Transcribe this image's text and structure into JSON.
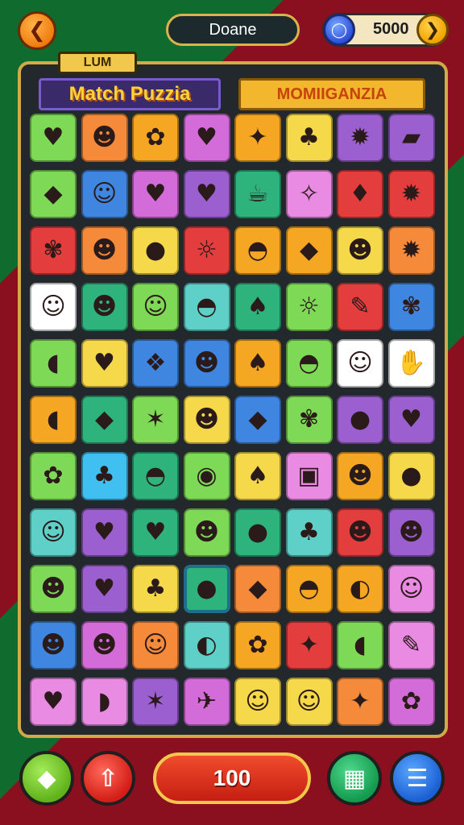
{
  "header": {
    "back_icon": "back-arrow-icon",
    "player_name": "Doane",
    "coins": "5000",
    "coin_icon": "coin-icon",
    "add_icon": "plus-icon"
  },
  "board": {
    "tag": "LUM",
    "title_left": "Match Puzzia",
    "title_right": "MOMIIGANZIA",
    "rows": [
      [
        {
          "g": "♥",
          "c": "#7ed957"
        },
        {
          "g": "☻",
          "c": "#f58a3a"
        },
        {
          "g": "✿",
          "c": "#f5a623"
        },
        {
          "g": "♥",
          "c": "#d36bd8"
        },
        {
          "g": "✦",
          "c": "#f5a623"
        },
        {
          "g": "♣",
          "c": "#f5d94a"
        },
        {
          "g": "✹",
          "c": "#9b5fd0"
        },
        {
          "g": "▰",
          "c": "#9b5fd0"
        }
      ],
      [
        {
          "g": "◆",
          "c": "#7ed957"
        },
        {
          "g": "☺",
          "c": "#3f86e0"
        },
        {
          "g": "♥",
          "c": "#d36bd8"
        },
        {
          "g": "♥",
          "c": "#9b5fd0"
        },
        {
          "g": "☕",
          "c": "#2fb37d"
        },
        {
          "g": "✧",
          "c": "#e98be3"
        },
        {
          "g": "♦",
          "c": "#e43d3d"
        },
        {
          "g": "✹",
          "c": "#e43d3d"
        }
      ],
      [
        {
          "g": "✾",
          "c": "#e43d3d"
        },
        {
          "g": "☻",
          "c": "#f58a3a"
        },
        {
          "g": "●",
          "c": "#f5d94a"
        },
        {
          "g": "☼",
          "c": "#e43d3d"
        },
        {
          "g": "◓",
          "c": "#f5a623"
        },
        {
          "g": "◆",
          "c": "#f5a623"
        },
        {
          "g": "☻",
          "c": "#f5d94a"
        },
        {
          "g": "✹",
          "c": "#f58a3a"
        }
      ],
      [
        {
          "g": "☺",
          "c": "#ffffff"
        },
        {
          "g": "☻",
          "c": "#2fb37d"
        },
        {
          "g": "☺",
          "c": "#7ed957"
        },
        {
          "g": "◓",
          "c": "#5fd0c8"
        },
        {
          "g": "♠",
          "c": "#2fb37d"
        },
        {
          "g": "☼",
          "c": "#7ed957"
        },
        {
          "g": "✎",
          "c": "#e43d3d"
        },
        {
          "g": "✾",
          "c": "#3f86e0"
        }
      ],
      [
        {
          "g": "◖",
          "c": "#7ed957"
        },
        {
          "g": "♥",
          "c": "#f5d94a"
        },
        {
          "g": "❖",
          "c": "#3f86e0"
        },
        {
          "g": "☻",
          "c": "#3f86e0"
        },
        {
          "g": "♠",
          "c": "#f5a623"
        },
        {
          "g": "◓",
          "c": "#7ed957"
        },
        {
          "g": "☺",
          "c": "#ffffff"
        },
        {
          "g": "✋",
          "c": "#ffffff"
        }
      ],
      [
        {
          "g": "◖",
          "c": "#f5a623"
        },
        {
          "g": "◆",
          "c": "#2fb37d"
        },
        {
          "g": "✶",
          "c": "#7ed957"
        },
        {
          "g": "☻",
          "c": "#f5d94a"
        },
        {
          "g": "◆",
          "c": "#3f86e0"
        },
        {
          "g": "✾",
          "c": "#7ed957"
        },
        {
          "g": "●",
          "c": "#9b5fd0"
        },
        {
          "g": "♥",
          "c": "#9b5fd0"
        }
      ],
      [
        {
          "g": "✿",
          "c": "#7ed957"
        },
        {
          "g": "♣",
          "c": "#3fc0f0"
        },
        {
          "g": "◓",
          "c": "#2fb37d"
        },
        {
          "g": "◉",
          "c": "#7ed957"
        },
        {
          "g": "♠",
          "c": "#f5d94a"
        },
        {
          "g": "▣",
          "c": "#e98be3"
        },
        {
          "g": "☻",
          "c": "#f5a623"
        },
        {
          "g": "●",
          "c": "#f5d94a"
        }
      ],
      [
        {
          "g": "☺",
          "c": "#5fd0c8"
        },
        {
          "g": "♥",
          "c": "#9b5fd0"
        },
        {
          "g": "♥",
          "c": "#2fb37d"
        },
        {
          "g": "☻",
          "c": "#7ed957"
        },
        {
          "g": "●",
          "c": "#2fb37d"
        },
        {
          "g": "♣",
          "c": "#5fd0c8"
        },
        {
          "g": "☻",
          "c": "#e43d3d"
        },
        {
          "g": "☻",
          "c": "#9b5fd0"
        }
      ],
      [
        {
          "g": "☻",
          "c": "#7ed957"
        },
        {
          "g": "♥",
          "c": "#9b5fd0"
        },
        {
          "g": "♣",
          "c": "#f5d94a"
        },
        {
          "g": "●",
          "c": "#2fb37d",
          "sel": true
        },
        {
          "g": "◆",
          "c": "#f58a3a"
        },
        {
          "g": "◓",
          "c": "#f5a623"
        },
        {
          "g": "◐",
          "c": "#f5a623"
        },
        {
          "g": "☺",
          "c": "#e98be3"
        }
      ],
      [
        {
          "g": "☻",
          "c": "#3f86e0"
        },
        {
          "g": "☻",
          "c": "#d36bd8"
        },
        {
          "g": "☺",
          "c": "#f58a3a"
        },
        {
          "g": "◐",
          "c": "#5fd0c8"
        },
        {
          "g": "✿",
          "c": "#f5a623"
        },
        {
          "g": "✦",
          "c": "#e43d3d"
        },
        {
          "g": "◖",
          "c": "#7ed957"
        },
        {
          "g": "✎",
          "c": "#e98be3"
        }
      ],
      [
        {
          "g": "♥",
          "c": "#e98be3"
        },
        {
          "g": "◗",
          "c": "#e98be3"
        },
        {
          "g": "✶",
          "c": "#9b5fd0"
        },
        {
          "g": "✈",
          "c": "#d36bd8"
        },
        {
          "g": "☺",
          "c": "#f5d94a"
        },
        {
          "g": "☺",
          "c": "#f5d94a"
        },
        {
          "g": "✦",
          "c": "#f58a3a"
        },
        {
          "g": "✿",
          "c": "#d36bd8"
        }
      ]
    ]
  },
  "footer": {
    "left_icon": "diamond-icon",
    "up_icon": "up-arrow-icon",
    "score": "100",
    "shop_icon": "shop-icon",
    "menu_icon": "menu-icon"
  }
}
